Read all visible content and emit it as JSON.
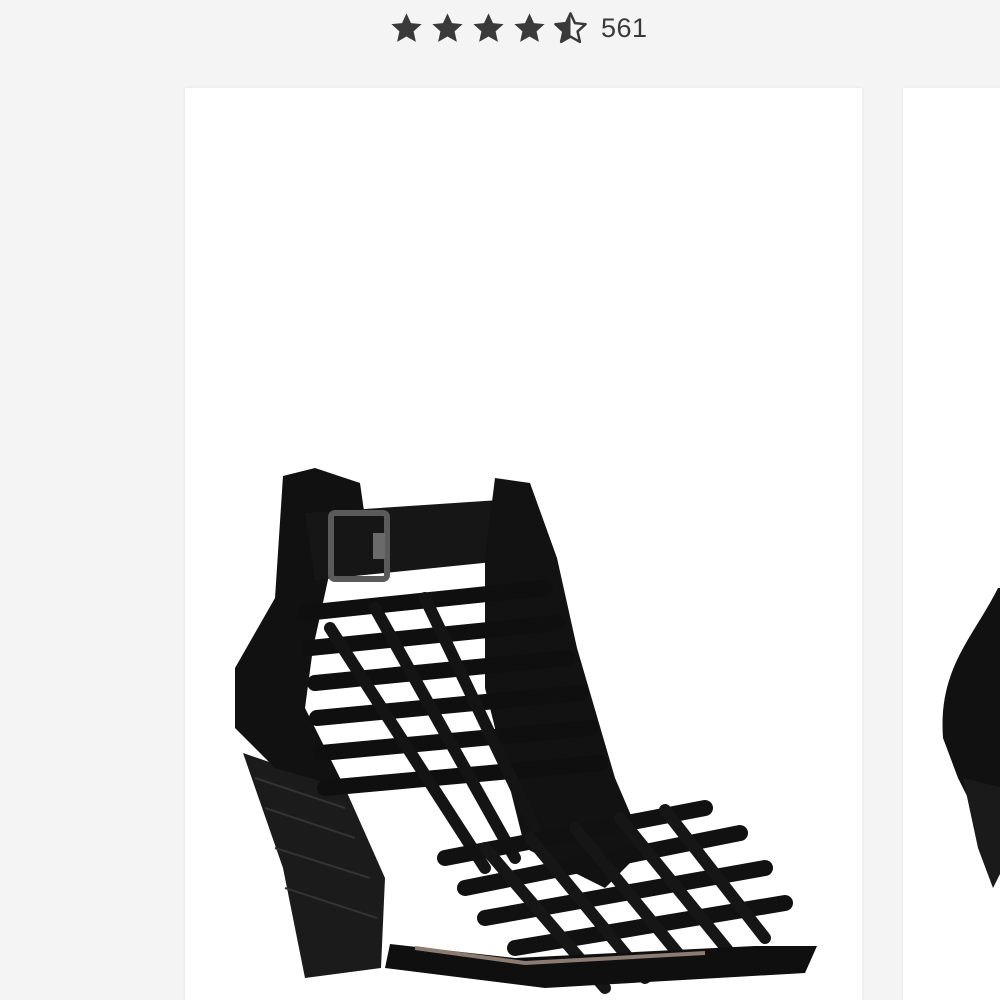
{
  "rating": {
    "value": 4.5,
    "max": 5,
    "review_count": "561",
    "star_color": "#3a3a3a"
  },
  "product_card": {
    "image_icon": "shoe-icon",
    "image_description_color": "#111111"
  }
}
